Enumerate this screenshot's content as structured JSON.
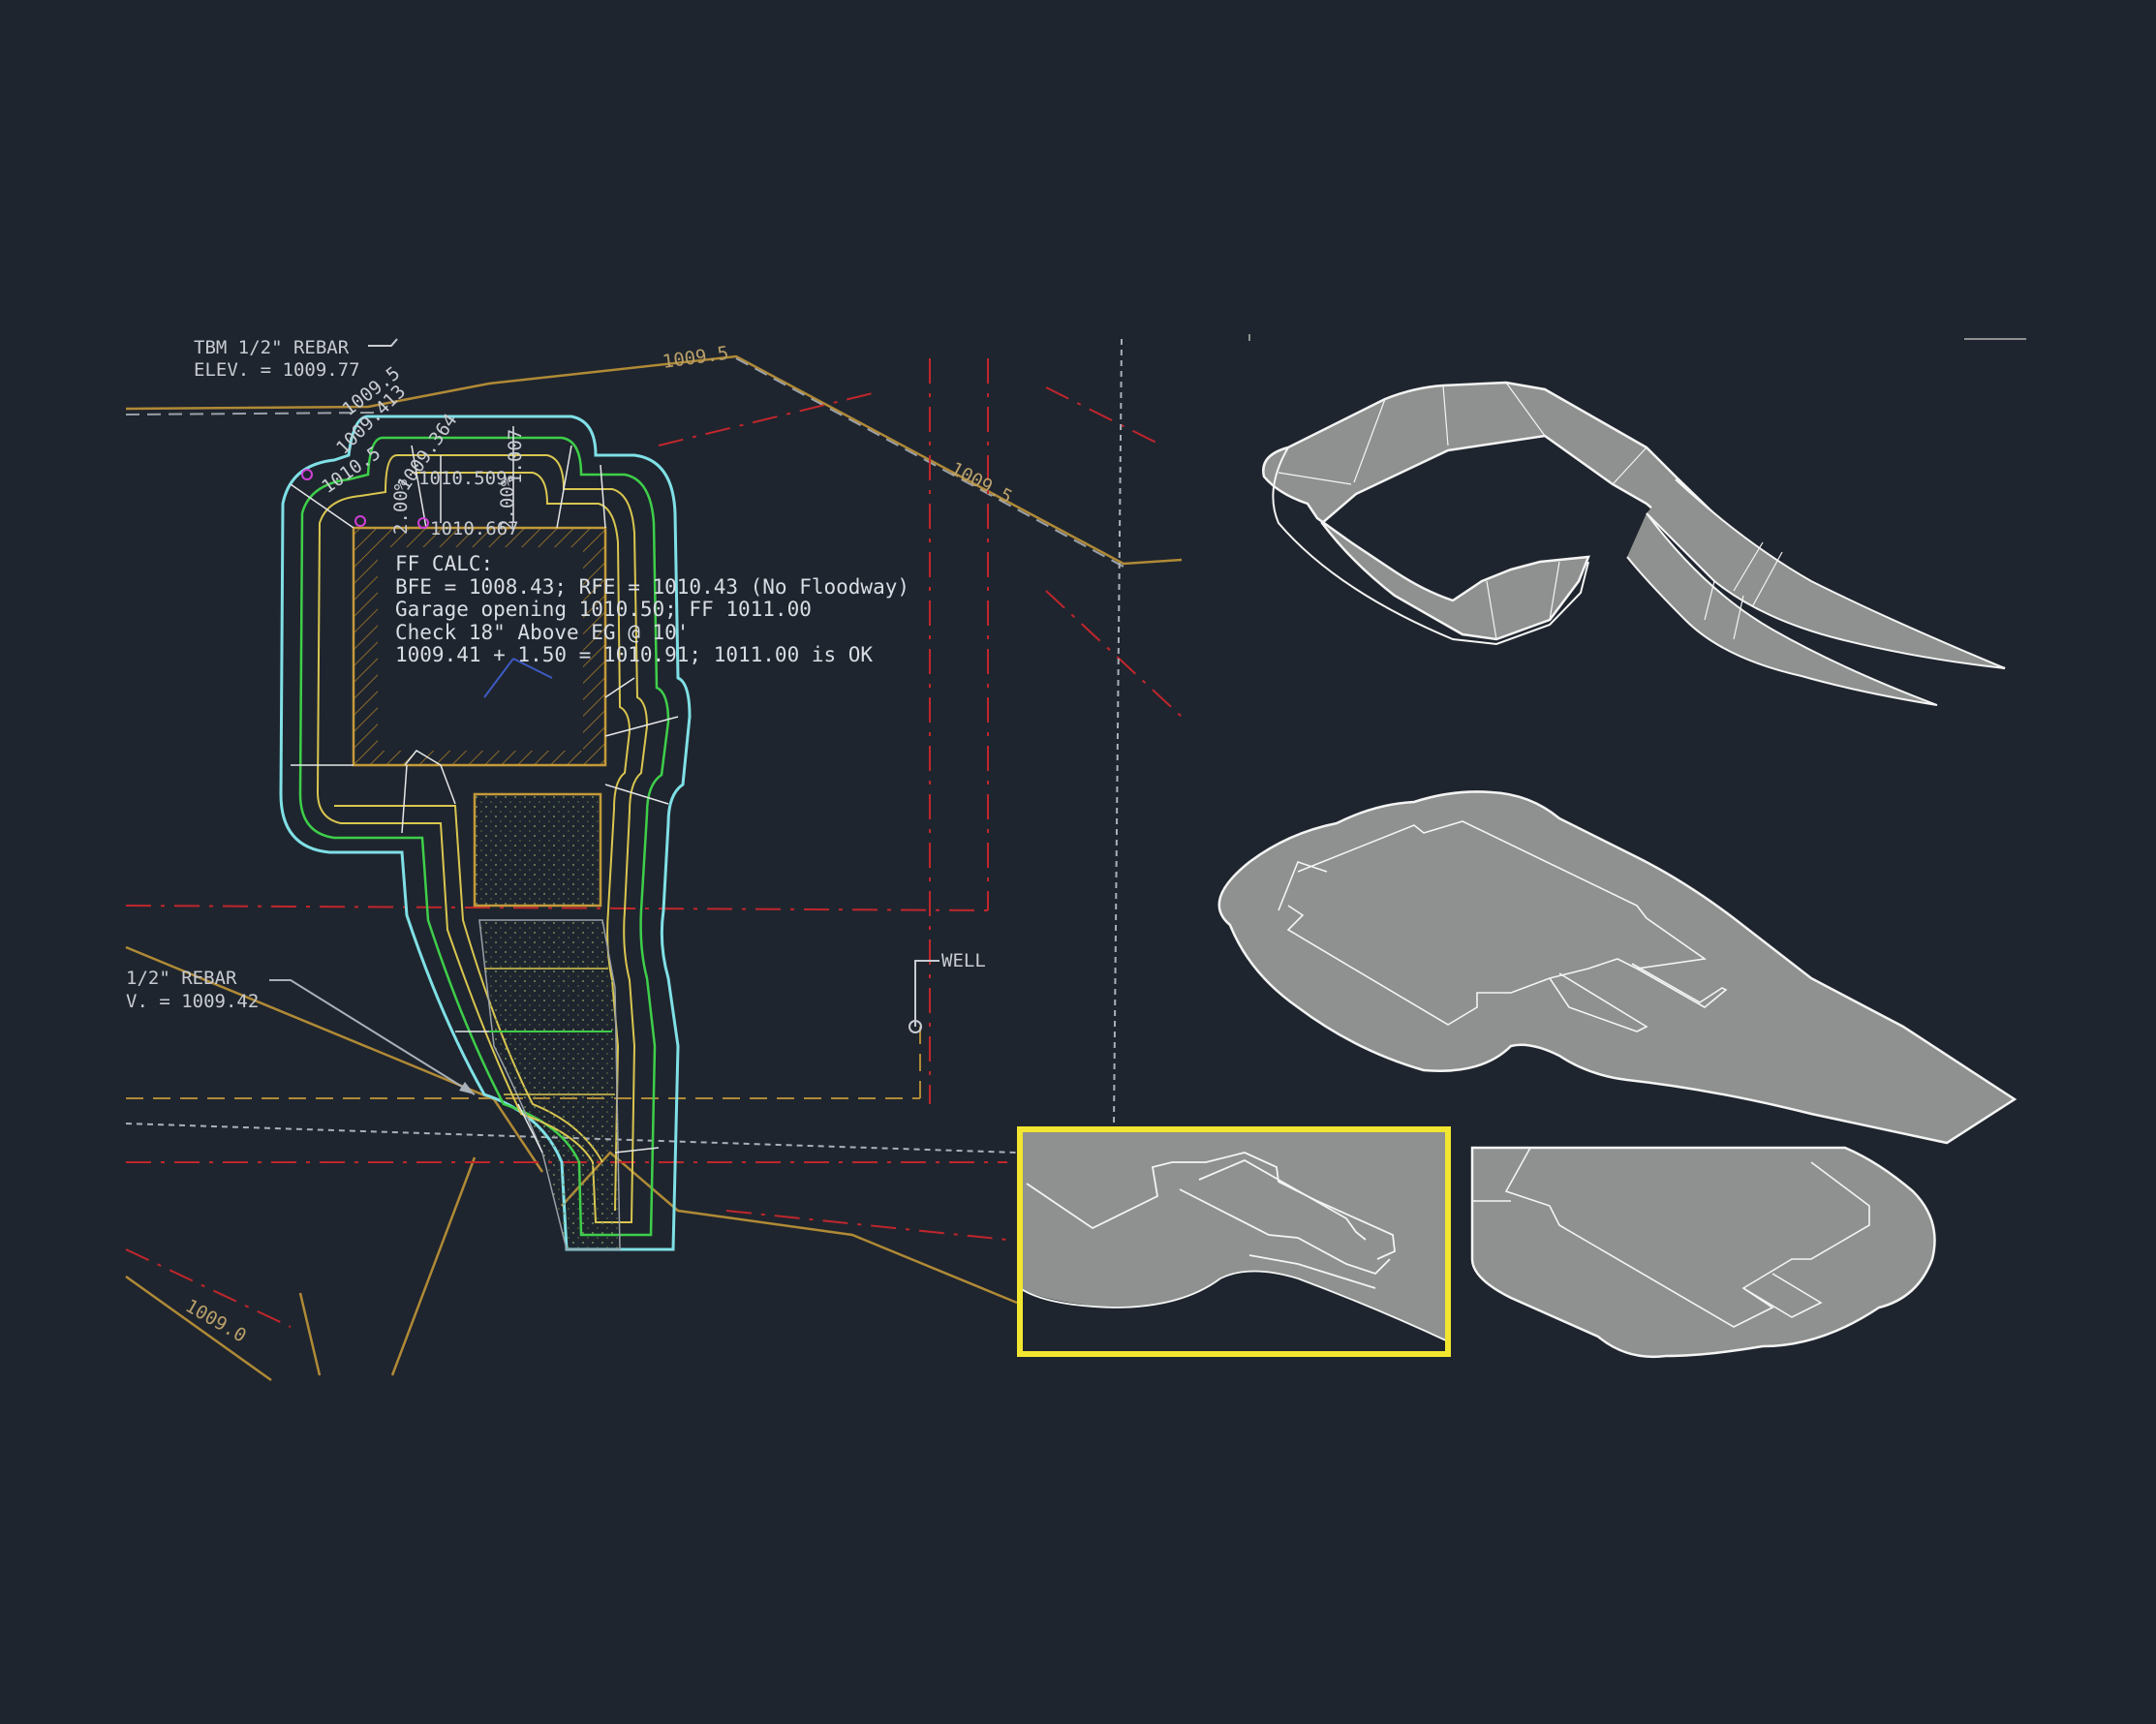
{
  "colors": {
    "background": "#1f252e",
    "highlight_box": "#f2e631",
    "boundary_line": "#b08a36",
    "setback_line": "#c0262c",
    "pad_cyan": "#7fe0e6",
    "pad_green": "#3ecf4a",
    "pad_yellow": "#d9c650",
    "surface_fill": "#8e918f",
    "surface_edge": "#f4f4f4"
  },
  "labels": {
    "tbm_top_line1": "TBM 1/2\" REBAR",
    "tbm_top_line2": "ELEV. = 1009.77",
    "tbm_left_line1": "1/2\" REBAR",
    "tbm_left_line2": "V. = 1009.42",
    "well": "WELL",
    "contour_top": "1009.5",
    "contour_slope": "1009.5",
    "contour_bottom": "1009.0",
    "spot_a": "1009.413",
    "spot_b": "1009.364",
    "spot_c": "1010.509",
    "spot_d": "1010.667",
    "spot_e": "1010.5",
    "spot_f": "1.007",
    "spot_g": "2.00%",
    "spot_h": "2.00%",
    "spot_i": "1009.5"
  },
  "ff_calc": {
    "title": "FF CALC:",
    "line1": "BFE = 1008.43; RFE = 1010.43 (No Floodway)",
    "line2": "Garage opening 1010.50; FF 1011.00",
    "line3": "Check 18\" Above EG @ 10'",
    "line4": "1009.41 + 1.50 = 1010.91; 1011.00 is OK"
  },
  "icons": {
    "well_symbol": "well-icon",
    "tbm_leader": "leader-arrow-icon"
  }
}
